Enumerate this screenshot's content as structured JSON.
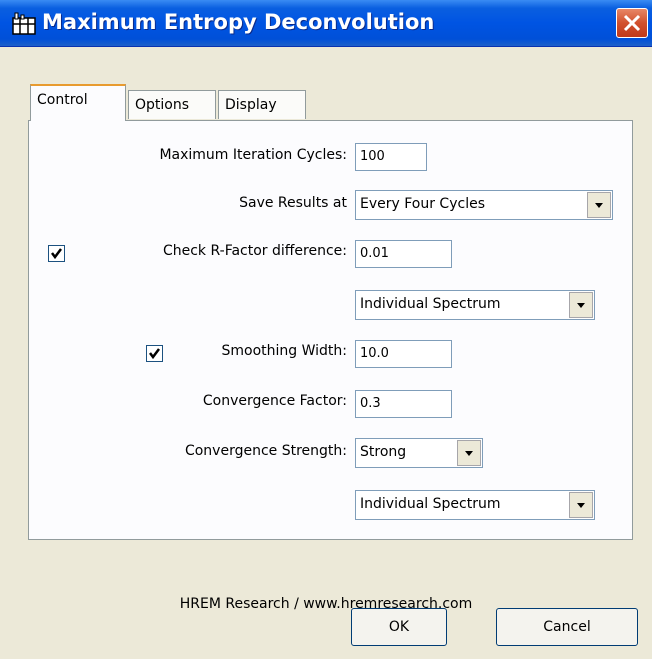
{
  "window": {
    "title": "Maximum Entropy Deconvolution"
  },
  "tabs": [
    {
      "label": "Control",
      "active": true
    },
    {
      "label": "Options",
      "active": false
    },
    {
      "label": "Display",
      "active": false
    }
  ],
  "control": {
    "max_iter_label": "Maximum Iteration Cycles:",
    "max_iter_value": "100",
    "save_results_label": "Save Results at",
    "save_results_value": "Every Four Cycles",
    "check_rfactor_label": "Check R-Factor difference:",
    "check_rfactor_checked": true,
    "rfactor_value": "0.01",
    "rfactor_mode": "Individual Spectrum",
    "smoothing_label": "Smoothing Width:",
    "smoothing_checked": true,
    "smoothing_value": "10.0",
    "conv_factor_label": "Convergence Factor:",
    "conv_factor_value": "0.3",
    "conv_strength_label": "Convergence Strength:",
    "conv_strength_value": "Strong",
    "conv_strength_mode": "Individual Spectrum"
  },
  "footer": {
    "credit": "HREM Research / www.hremresearch.com"
  },
  "buttons": {
    "ok": "OK",
    "cancel": "Cancel"
  }
}
